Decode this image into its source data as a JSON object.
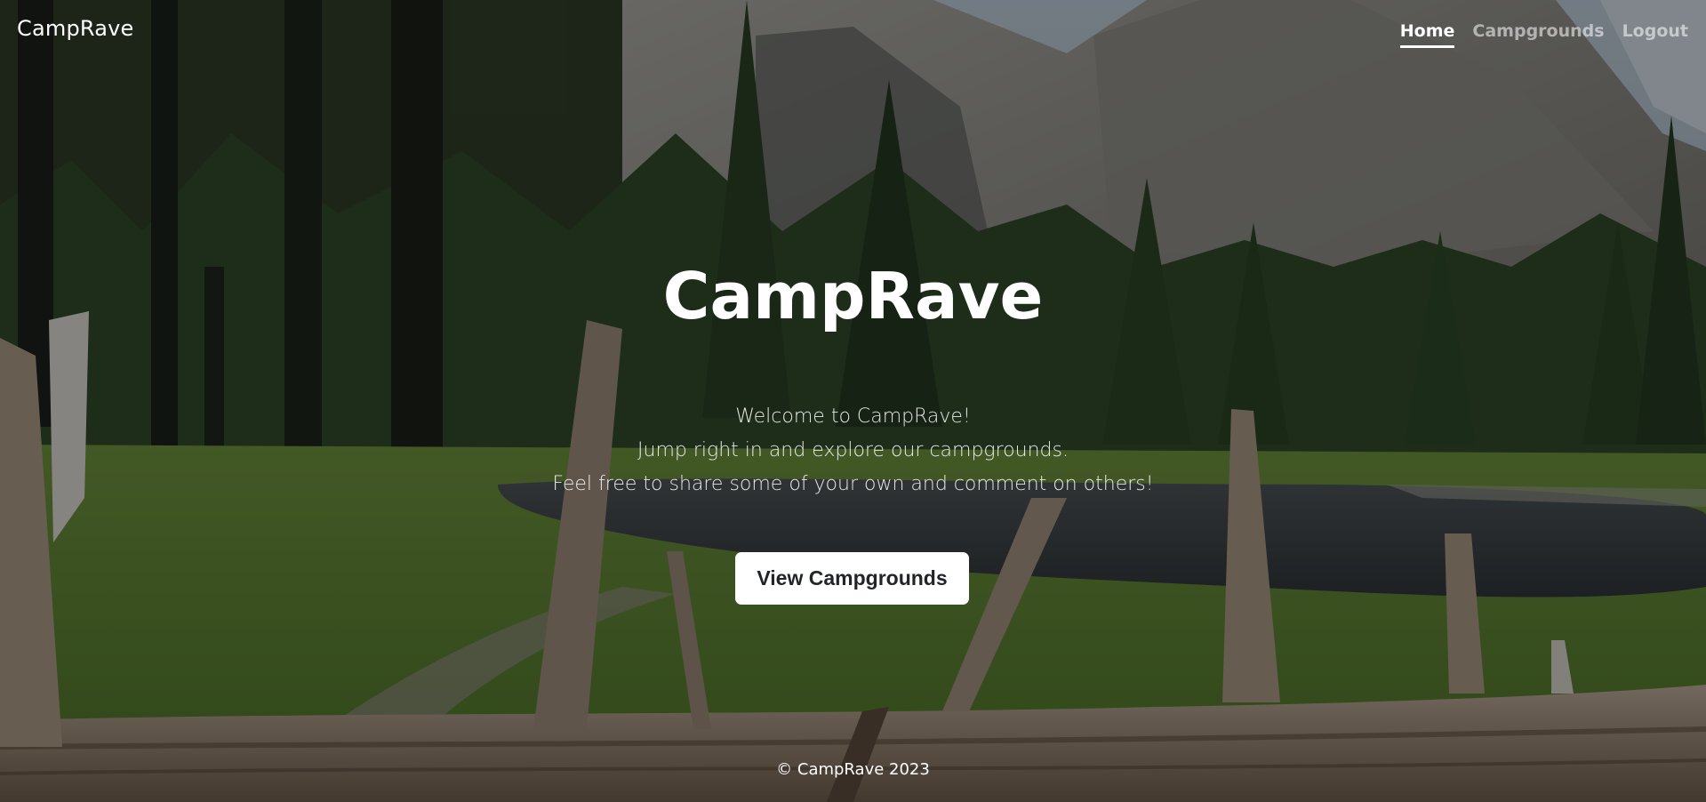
{
  "navbar": {
    "brand": "CampRave",
    "links": [
      {
        "label": "Home",
        "active": true
      },
      {
        "label": "Campgrounds",
        "active": false
      },
      {
        "label": "Logout",
        "active": false
      }
    ]
  },
  "hero": {
    "title": "CampRave",
    "lead_lines": [
      "Welcome to CampRave!",
      "Jump right in and explore our campgrounds.",
      "Feel free to share some of your own and comment on others!"
    ],
    "cta_label": "View Campgrounds"
  },
  "footer": {
    "text": "© CampRave 2023"
  },
  "colors": {
    "text": "#ffffff",
    "button_bg": "#ffffff",
    "button_text": "#212529"
  }
}
